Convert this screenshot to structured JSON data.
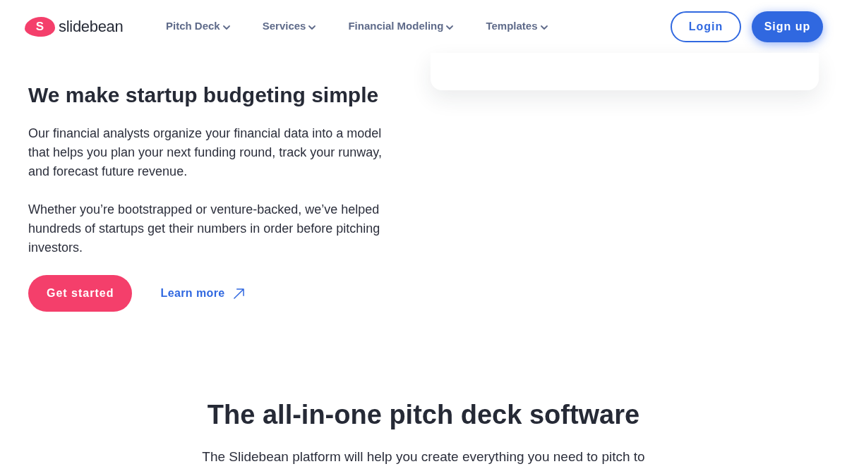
{
  "header": {
    "logo": {
      "mark": "S",
      "text": "slidebean"
    },
    "nav": [
      {
        "label": "Pitch Deck",
        "has_dropdown": true
      },
      {
        "label": "Services",
        "has_dropdown": true
      },
      {
        "label": "Financial Modeling",
        "has_dropdown": true
      },
      {
        "label": "Templates",
        "has_dropdown": true
      }
    ],
    "actions": [
      {
        "label": "Login",
        "kind": "outline"
      },
      {
        "label": "Sign up",
        "kind": "filled"
      }
    ]
  },
  "hero": {
    "title": "We make startup budgeting simple",
    "paragraphs": [
      "Our financial analysts organize your financial data into a model that helps you plan your next funding round, track your runway, and forecast future revenue.",
      "Whether you’re bootstrapped or venture-backed, we’ve helped hundreds of startups get their numbers in order before pitching investors."
    ],
    "buttons": [
      {
        "label": "Get started",
        "kind": "primary"
      },
      {
        "label": "Learn more",
        "kind": "link"
      }
    ]
  },
  "section": {
    "title": "The all-in-one pitch deck software",
    "text": "The Slidebean platform will help you create everything you need to pitch to"
  }
}
